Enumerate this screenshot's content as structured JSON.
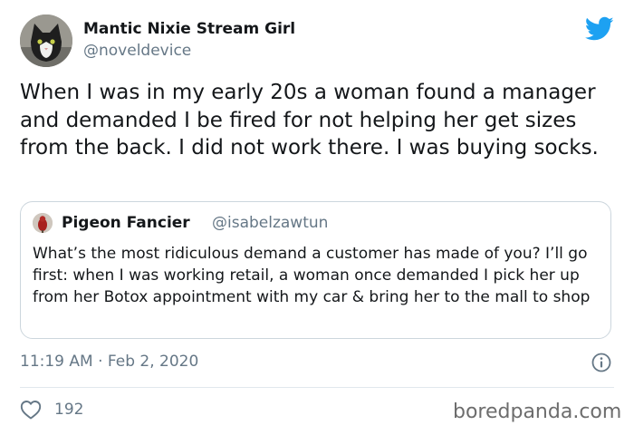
{
  "tweet": {
    "author_name": "Mantic Nixie Stream Girl",
    "author_handle": "@noveldevice",
    "text": "When I was in my early 20s a woman found a manager and demanded I be fired for not helping her get sizes from the back. I did not work there. I was buying socks.",
    "time": "11:19 AM · Feb 2, 2020",
    "likes": "192"
  },
  "quoted_tweet": {
    "author_name": "Pigeon Fancier",
    "author_handle": "@isabelzawtun",
    "text": "What’s the most ridiculous demand a customer has made of you? I’ll go first: when I was working retail, a woman once demanded I pick her up from her Botox appointment with my car & bring her to the mall to shop"
  },
  "watermark": "boredpanda.com",
  "colors": {
    "twitter_blue": "#1da1f2",
    "secondary_text": "#657786",
    "border": "#ccd6dd"
  },
  "icons": {
    "brand": "twitter-bird-icon",
    "info": "info-icon",
    "like": "heart-icon"
  }
}
